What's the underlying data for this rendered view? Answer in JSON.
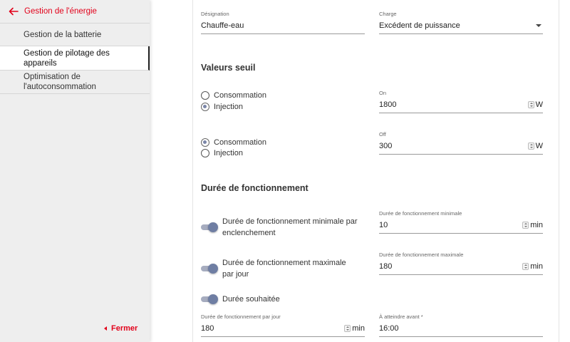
{
  "sidebar": {
    "back_label": "Gestion de l'énergie",
    "items": [
      {
        "label": "Gestion de la batterie"
      },
      {
        "label": "Gestion de pilotage des appareils"
      },
      {
        "label": "Optimisation de l'autoconsommation"
      }
    ],
    "close_label": "Fermer"
  },
  "form": {
    "designation": {
      "label": "Désignation",
      "value": "Chauffe-eau"
    },
    "charge": {
      "label": "Charge",
      "value": "Excédent de puissance"
    },
    "thresholds": {
      "title": "Valeurs seuil",
      "on": {
        "options": [
          "Consommation",
          "Injection"
        ],
        "selected": "Injection",
        "label": "On",
        "value": "1800",
        "unit": "W"
      },
      "off": {
        "options": [
          "Consommation",
          "Injection"
        ],
        "selected": "Consommation",
        "label": "Off",
        "value": "300",
        "unit": "W"
      }
    },
    "runtime": {
      "title": "Durée de fonctionnement",
      "min_toggle_label": "Durée de fonctionnement minimale par enclenchement",
      "min_field": {
        "label": "Durée de fonctionnement minimale",
        "value": "10",
        "unit": "min"
      },
      "max_toggle_label": "Durée de fonctionnement maximale par jour",
      "max_field": {
        "label": "Durée de fonctionnement maximale",
        "value": "180",
        "unit": "min"
      },
      "desired_toggle_label": "Durée souhaitée",
      "per_day_field": {
        "label": "Durée de fonctionnement par jour",
        "value": "180",
        "unit": "min"
      },
      "deadline_field": {
        "label": "À atteindre avant *",
        "value": "16:00"
      }
    }
  },
  "colors": {
    "accent": "#e2001a",
    "toggle": "#6f7ea3"
  }
}
